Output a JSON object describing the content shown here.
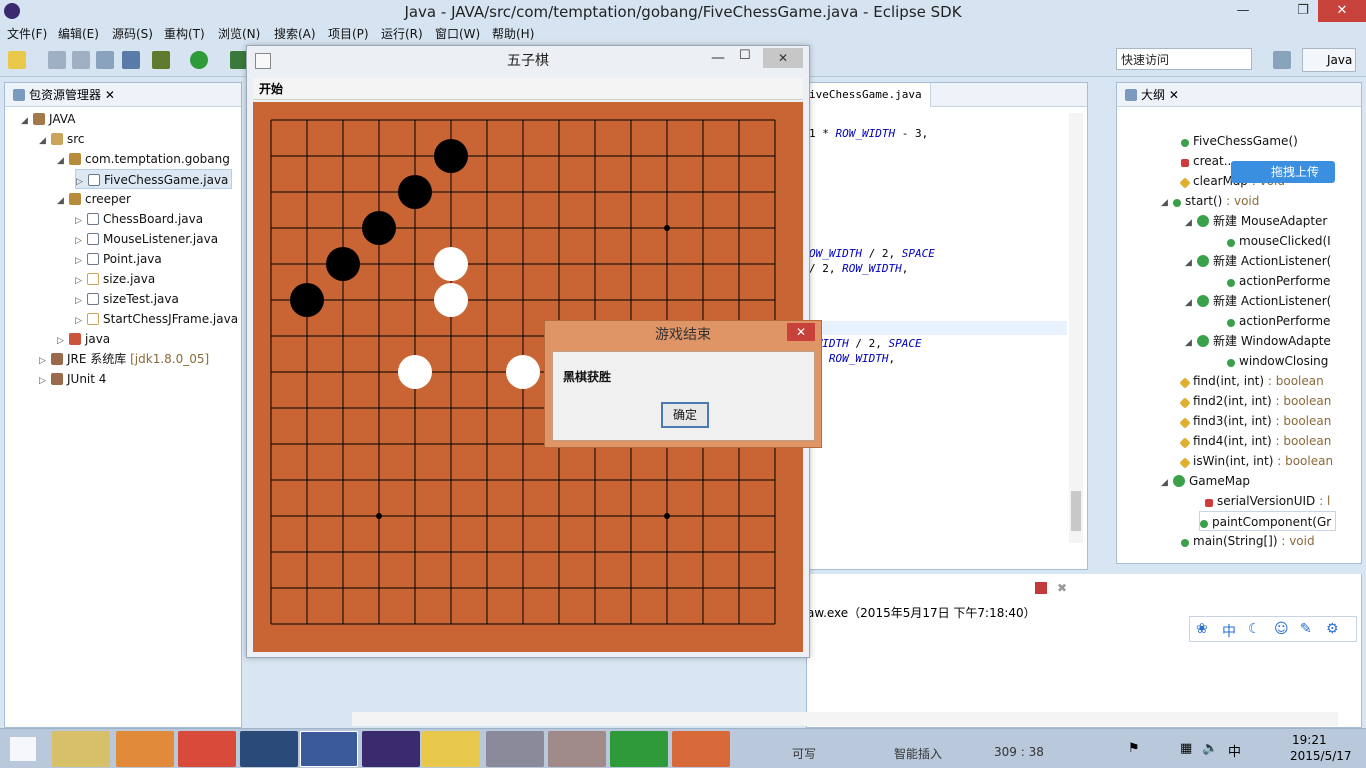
{
  "window_title": "Java  -  JAVA/src/com/temptation/gobang/FiveChessGame.java  -  Eclipse SDK",
  "menus": [
    "文件(F)",
    "编辑(E)",
    "源码(S)",
    "重构(T)",
    "浏览(N)",
    "搜索(A)",
    "项目(P)",
    "运行(R)",
    "窗口(W)",
    "帮助(H)"
  ],
  "quick_access": "快速访问",
  "perspective": "Java",
  "package_explorer": {
    "title": "包资源管理器",
    "items": [
      "JAVA",
      "src",
      "com.temptation.gobang",
      "FiveChessGame.java",
      "creeper",
      "ChessBoard.java",
      "MouseListener.java",
      "Point.java",
      "size.java",
      "sizeTest.java",
      "StartChessJFrame.java",
      "java",
      "JRE 系统库",
      "[jdk1.8.0_05]",
      "JUnit 4"
    ]
  },
  "editor": {
    "tab": "iveChessGame.java",
    "lines": [
      {
        "pre": "1 * ",
        "c": "ROW_WIDTH",
        "post": " - 3,"
      },
      {
        "pre": "",
        "c": "OW_WIDTH",
        "post": " / 2, ",
        "c2": "SPACE"
      },
      {
        "pre": "/ 2, ",
        "c": "ROW_WIDTH",
        "post": ","
      },
      {
        "pre": "",
        "c": "_WIDTH",
        "post": " / 2, ",
        "c2": "SPACE"
      },
      {
        "pre": "2, ",
        "c": "ROW_WIDTH",
        "post": ","
      }
    ]
  },
  "console": {
    "text": "aw.exe（2015年5月17日 下午7:18:40）"
  },
  "outline": {
    "title": "大纲",
    "items": [
      {
        "name": "FiveChessGame()",
        "ret": ""
      },
      {
        "name": "creat..",
        "ret": ""
      },
      {
        "name": "clearMap",
        "ret": " : void"
      },
      {
        "name": "start()",
        "ret": " : void"
      },
      {
        "name": "新建 MouseAdapter",
        "ret": ""
      },
      {
        "name": "mouseClicked(I",
        "ret": ""
      },
      {
        "name": "新建 ActionListener(",
        "ret": ""
      },
      {
        "name": "actionPerforme",
        "ret": ""
      },
      {
        "name": "新建 ActionListener(",
        "ret": ""
      },
      {
        "name": "actionPerforme",
        "ret": ""
      },
      {
        "name": "新建 WindowAdapte",
        "ret": ""
      },
      {
        "name": "windowClosing",
        "ret": ""
      },
      {
        "name": "find(int, int)",
        "ret": " : boolean"
      },
      {
        "name": "find2(int, int)",
        "ret": " : boolean"
      },
      {
        "name": "find3(int, int)",
        "ret": " : boolean"
      },
      {
        "name": "find4(int, int)",
        "ret": " : boolean"
      },
      {
        "name": "isWin(int, int)",
        "ret": " : boolean"
      },
      {
        "name": "GameMap",
        "ret": ""
      },
      {
        "name": "serialVersionUID",
        "ret": " : l"
      },
      {
        "name": "paintComponent(Gr",
        "ret": ""
      },
      {
        "name": "main(String[])",
        "ret": " : void"
      }
    ],
    "upload_btn": "拖拽上传"
  },
  "ime_bar": [
    "中"
  ],
  "game": {
    "title": "五子棋",
    "menu": "开始",
    "board_size": 15,
    "black": [
      [
        5,
        1
      ],
      [
        4,
        2
      ],
      [
        3,
        3
      ],
      [
        2,
        4
      ],
      [
        1,
        5
      ]
    ],
    "white": [
      [
        5,
        4
      ],
      [
        5,
        5
      ],
      [
        4,
        7
      ],
      [
        7,
        7
      ]
    ],
    "star_points": [
      [
        11,
        3
      ],
      [
        3,
        11
      ],
      [
        11,
        11
      ]
    ]
  },
  "dialog": {
    "title": "游戏结束",
    "message": "黑棋获胜",
    "ok": "确定"
  },
  "status": {
    "writable": "可写",
    "insert": "智能插入",
    "pos": "309 : 38"
  },
  "clock": {
    "time": "19:21",
    "date": "2015/5/17"
  },
  "tray_lang": "中"
}
